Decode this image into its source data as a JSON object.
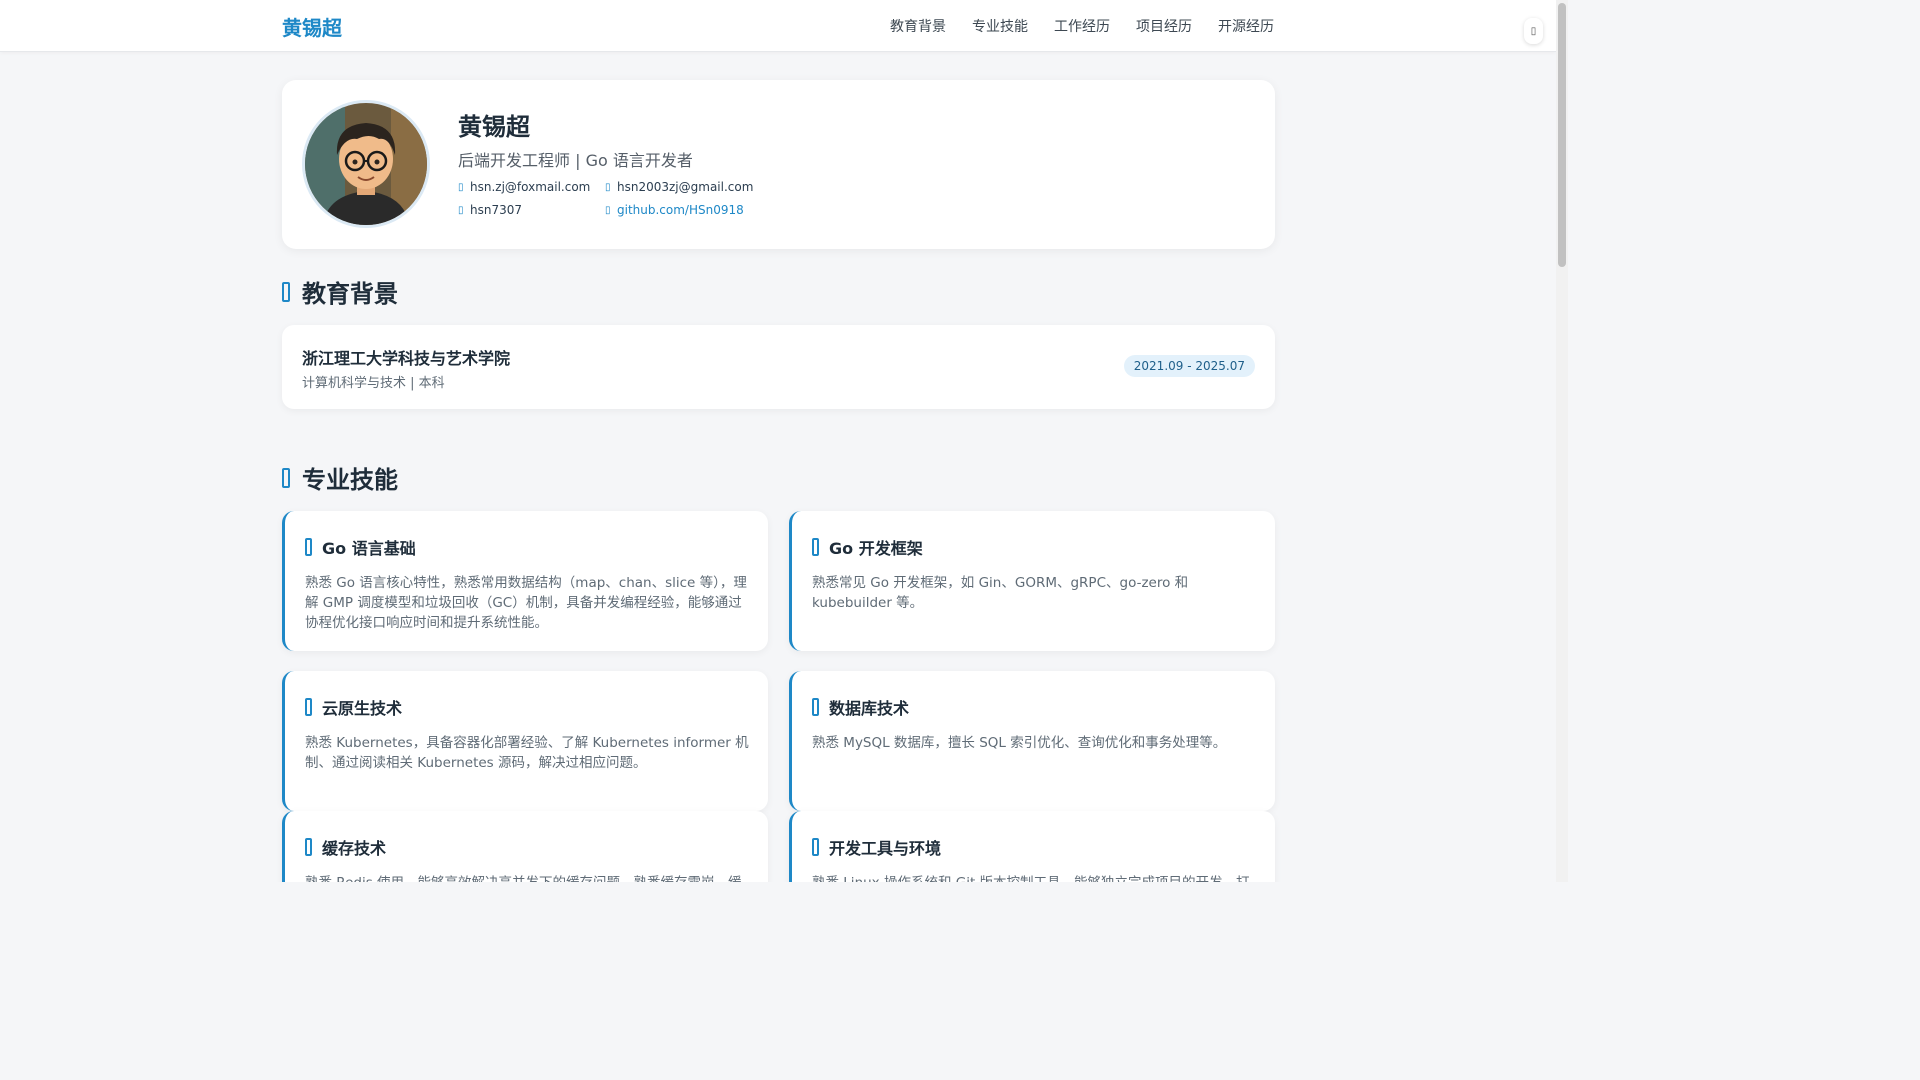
{
  "nav": {
    "brand": "黄锡超",
    "links": [
      "教育背景",
      "专业技能",
      "工作经历",
      "项目经历",
      "开源经历"
    ]
  },
  "profile": {
    "name": "黄锡超",
    "title": "后端开发工程师 | Go 语言开发者",
    "contacts": {
      "email1": "hsn.zj@foxmail.com",
      "email2": "hsn2003zj@gmail.com",
      "wechat": "hsn7307",
      "github": "github.com/HSn0918"
    }
  },
  "education": {
    "heading": "教育背景",
    "school": "浙江理工大学科技与艺术学院",
    "major": "计算机科学与技术 | 本科",
    "date": "2021.09 - 2025.07"
  },
  "skills": {
    "heading": "专业技能",
    "items": [
      {
        "title": "Go 语言基础",
        "desc": "熟悉 Go 语言核心特性，熟悉常用数据结构（map、chan、slice 等），理解 GMP 调度模型和垃圾回收（GC）机制，具备并发编程经验，能够通过协程优化接口响应时间和提升系统性能。"
      },
      {
        "title": "Go 开发框架",
        "desc": "熟悉常见 Go 开发框架，如 Gin、GORM、gRPC、go-zero 和 kubebuilder 等。"
      },
      {
        "title": "云原生技术",
        "desc": "熟悉 Kubernetes，具备容器化部署经验、了解 Kubernetes informer 机制、通过阅读相关 Kubernetes 源码，解决过相应问题。"
      },
      {
        "title": "数据库技术",
        "desc": "熟悉 MySQL 数据库，擅长 SQL 索引优化、查询优化和事务处理等。"
      },
      {
        "title": "缓存技术",
        "desc": "熟悉 Redis 使用，能够高效解决高并发下的缓存问题，熟悉缓存雪崩、缓存"
      },
      {
        "title": "开发工具与环境",
        "desc": "熟悉 Linux 操作系统和 Git 版本控制工具，能够独立完成项目的开发、打包"
      }
    ]
  },
  "colors": {
    "accent": "#1e88c7",
    "page_bg": "#f5f6f8",
    "card_bg": "#ffffff"
  }
}
